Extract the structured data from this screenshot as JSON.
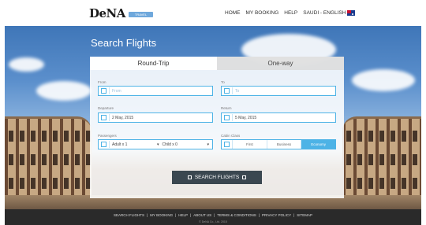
{
  "header": {
    "logo_text": "DeNA",
    "logo_badge": "TRAVEL",
    "nav": [
      "HOME",
      "MY BOOKING",
      "HELP"
    ],
    "language": "SAUDI - ENGLISH"
  },
  "hero": {
    "title": "Search Flights"
  },
  "tabs": [
    "Round-Trip",
    "One-way"
  ],
  "form": {
    "from_label": "From",
    "from_placeholder": "From",
    "to_label": "To",
    "to_placeholder": "To",
    "departure_label": "Departure",
    "departure_value": "2 May, 2015",
    "return_label": "Return",
    "return_value": "5 May, 2015",
    "passengers_label": "Passengers",
    "adults": "Adult x 1",
    "child": "Child x 0",
    "cabin_label": "Cabin Class",
    "cabin_options": [
      "First",
      "Business",
      "Economy"
    ],
    "cabin_selected": "Economy",
    "submit_label": "SEARCH FLIGHTS"
  },
  "footer": {
    "links": [
      "SEARCH FLIGHTS",
      "MY BOOKING",
      "HELP",
      "ABOUT US",
      "TERMS & CONDITIONS",
      "PRIVACY POLICY",
      "SITEMAP"
    ],
    "copyright": "© DeNA Co., Ltd. 2015"
  },
  "colors": {
    "accent": "#4db3e6",
    "button": "#3a4750",
    "footer": "#2a2a2a"
  }
}
